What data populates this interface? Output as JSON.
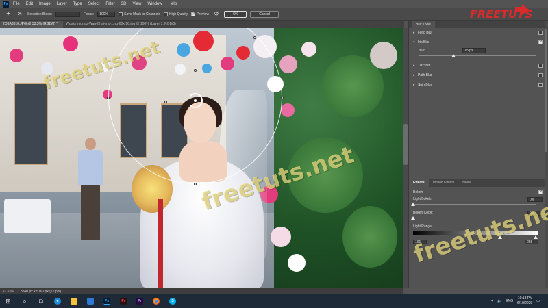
{
  "menubar": {
    "items": [
      "File",
      "Edit",
      "Image",
      "Layer",
      "Type",
      "Select",
      "Filter",
      "3D",
      "View",
      "Window",
      "Help"
    ]
  },
  "options": {
    "selection_bleed_label": "Selection Bleed:",
    "focus_label": "Focus:",
    "focus_value": "100%",
    "save_mask_label": "Save Mask to Channels",
    "high_quality_label": "High Quality",
    "preview_label": "Preview",
    "ok_label": "OK",
    "cancel_label": "Cancel"
  },
  "doc_tabs": [
    "2Q9A8310.JPG @ 33.3% (RGB/8) *",
    "Woolonmonoo-Wan-Chai-mu-...ng-60x-16.jpg @ 100% (Layer 1, RGB/8)"
  ],
  "panel": {
    "title": "Blur Tools",
    "blur_tools": [
      {
        "name": "Field Blur",
        "checked": false,
        "expanded": false
      },
      {
        "name": "Iris Blur",
        "checked": true,
        "expanded": true
      },
      {
        "name": "Tilt-Shift",
        "checked": false,
        "expanded": false
      },
      {
        "name": "Path Blur",
        "checked": false,
        "expanded": false
      },
      {
        "name": "Spin Blur",
        "checked": false,
        "expanded": false
      }
    ],
    "iris_blur": {
      "label": "Blur:",
      "value": "15 px",
      "slider_fraction": 0.3
    },
    "effects_tabs": [
      "Effects",
      "Motion Effects",
      "Noise"
    ],
    "bokeh_label": "Bokeh",
    "bokeh_checked": true,
    "light_bokeh": {
      "label": "Light Bokeh:",
      "value": "0%",
      "slider_fraction": 0.0
    },
    "bokeh_color": {
      "label": "Bokeh Color:",
      "value": "0%",
      "slider_fraction": 0.0
    },
    "light_range": {
      "label": "Light Range:",
      "low": "191",
      "high": "255"
    }
  },
  "statusbar": {
    "zoom": "33.33%",
    "doc_size": "3840 px x 5760 px (72 ppi)"
  },
  "watermarks": [
    "freetuts.net",
    "freetuts.net",
    "freetuts.net",
    "freetuts.net"
  ],
  "logo": {
    "text": "FREETUTS"
  },
  "taskbar": {
    "lang": "ENG",
    "time": "10:18 PM",
    "date": "6/10/2020",
    "apps": [
      "Ps",
      "Pr",
      "Pr",
      "Ps"
    ]
  },
  "colors": {
    "panel_bg": "#535353",
    "accent_logo_red": "#d92b2b",
    "ps_blue": "#31a8ff",
    "pr_purple": "#9999ff"
  }
}
